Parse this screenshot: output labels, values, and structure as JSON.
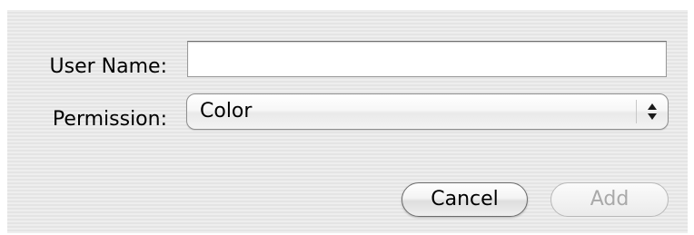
{
  "form": {
    "user_name_label": "User Name:",
    "user_name_value": "",
    "permission_label": "Permission:",
    "permission_selected": "Color"
  },
  "buttons": {
    "cancel_label": "Cancel",
    "add_label": "Add",
    "add_enabled": false
  },
  "icons": {
    "popup_arrows": "up-down-arrows-icon"
  }
}
